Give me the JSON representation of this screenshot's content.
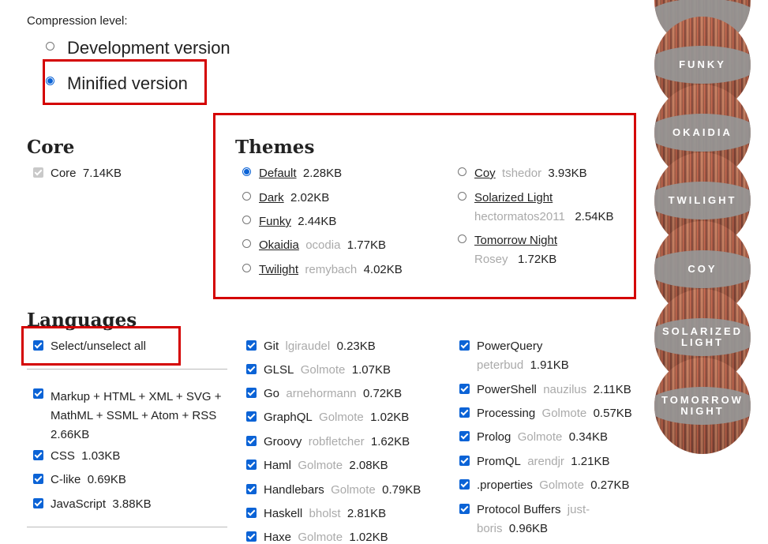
{
  "compression": {
    "label": "Compression level:",
    "options": [
      {
        "label": "Development version",
        "selected": false
      },
      {
        "label": "Minified version",
        "selected": true
      }
    ]
  },
  "core": {
    "heading": "Core",
    "item": {
      "name": "Core",
      "size": "7.14KB",
      "checked": true,
      "disabled": true
    }
  },
  "themes": {
    "heading": "Themes",
    "left": [
      {
        "name": "Default",
        "author": "",
        "size": "2.28KB",
        "selected": true
      },
      {
        "name": "Dark",
        "author": "",
        "size": "2.02KB",
        "selected": false
      },
      {
        "name": "Funky",
        "author": "",
        "size": "2.44KB",
        "selected": false
      },
      {
        "name": "Okaidia",
        "author": "ocodia",
        "size": "1.77KB",
        "selected": false
      },
      {
        "name": "Twilight",
        "author": "remybach",
        "size": "4.02KB",
        "selected": false
      }
    ],
    "right": [
      {
        "name": "Coy",
        "author": "tshedor",
        "size": "3.93KB",
        "selected": false
      },
      {
        "name": "Solarized Light",
        "author": "hectormatos2011",
        "size": "2.54KB",
        "selected": false
      },
      {
        "name": "Tomorrow Night",
        "author": "Rosey",
        "size": "1.72KB",
        "selected": false
      }
    ]
  },
  "languages": {
    "heading": "Languages",
    "select_all": "Select/unselect all",
    "col1": [
      {
        "line1": "Markup + HTML + XML + SVG +",
        "line2": "MathML + SSML + Atom + RSS",
        "size": "2.66KB"
      },
      {
        "name": "CSS",
        "author": "",
        "size": "1.03KB"
      },
      {
        "name": "C-like",
        "author": "",
        "size": "0.69KB"
      },
      {
        "name": "JavaScript",
        "author": "",
        "size": "3.88KB"
      }
    ],
    "col2": [
      {
        "name": "Git",
        "author": "lgiraudel",
        "size": "0.23KB"
      },
      {
        "name": "GLSL",
        "author": "Golmote",
        "size": "1.07KB"
      },
      {
        "name": "Go",
        "author": "arnehormann",
        "size": "0.72KB"
      },
      {
        "name": "GraphQL",
        "author": "Golmote",
        "size": "1.02KB"
      },
      {
        "name": "Groovy",
        "author": "robfletcher",
        "size": "1.62KB"
      },
      {
        "name": "Haml",
        "author": "Golmote",
        "size": "2.08KB"
      },
      {
        "name": "Handlebars",
        "author": "Golmote",
        "size": "0.79KB"
      },
      {
        "name": "Haskell",
        "author": "bholst",
        "size": "2.81KB"
      },
      {
        "name": "Haxe",
        "author": "Golmote",
        "size": "1.02KB"
      }
    ],
    "col3": [
      {
        "name": "PowerQuery",
        "author": "peterbud",
        "size": "1.91KB"
      },
      {
        "name": "PowerShell",
        "author": "nauzilus",
        "size": "2.11KB"
      },
      {
        "name": "Processing",
        "author": "Golmote",
        "size": "0.57KB"
      },
      {
        "name": "Prolog",
        "author": "Golmote",
        "size": "0.34KB"
      },
      {
        "name": "PromQL",
        "author": "arendjr",
        "size": "1.21KB"
      },
      {
        "name": ".properties",
        "author": "Golmote",
        "size": "0.27KB"
      },
      {
        "name": "Protocol Buffers",
        "author_line1": "just-",
        "author_line2": "boris",
        "size": "0.96KB"
      }
    ]
  },
  "previews": [
    "FUNKY",
    "OKAIDIA",
    "TWILIGHT",
    "COY",
    "SOLARIZED",
    "LIGHT",
    "TOMORROW",
    "NIGHT"
  ],
  "colors": {
    "accent": "#0b63d6",
    "highlight_box": "#d40000"
  }
}
